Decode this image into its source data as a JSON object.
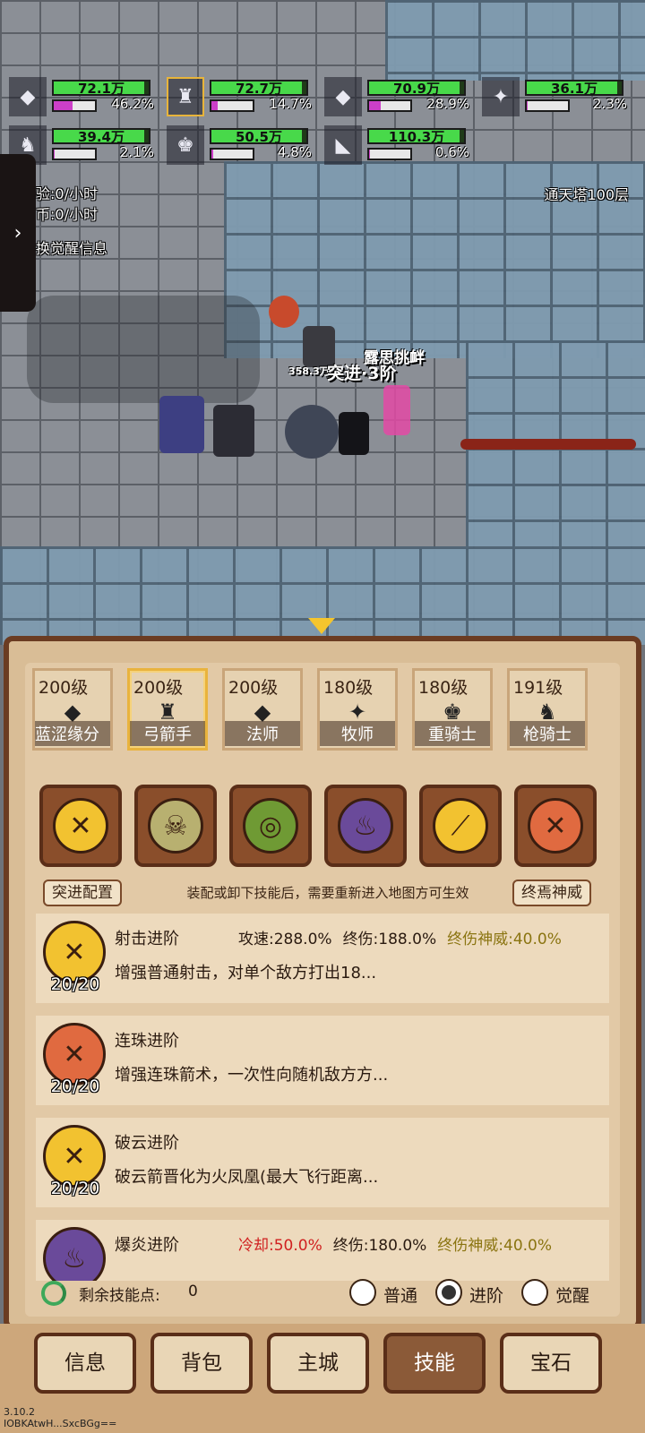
{
  "units": [
    {
      "hp_text": "72.1万",
      "hp_fraction": 0.95,
      "mp_text": "46.2%",
      "mp_fraction": 0.462,
      "icon": "ghost-sprite-icon",
      "selected": false
    },
    {
      "hp_text": "72.7万",
      "hp_fraction": 0.95,
      "mp_text": "14.7%",
      "mp_fraction": 0.147,
      "icon": "archer-sprite-icon",
      "selected": true
    },
    {
      "hp_text": "70.9万",
      "hp_fraction": 0.95,
      "mp_text": "28.9%",
      "mp_fraction": 0.289,
      "icon": "ghost-sprite-icon",
      "selected": false
    },
    {
      "hp_text": "36.1万",
      "hp_fraction": 0.95,
      "mp_text": "2.3%",
      "mp_fraction": 0.023,
      "icon": "priest-sprite-icon",
      "selected": false
    },
    {
      "hp_text": "39.4万",
      "hp_fraction": 0.95,
      "mp_text": "2.1%",
      "mp_fraction": 0.021,
      "icon": "lancer-sprite-icon",
      "selected": false
    },
    {
      "hp_text": "50.5万",
      "hp_fraction": 0.95,
      "mp_text": "4.8%",
      "mp_fraction": 0.048,
      "icon": "knight-sprite-icon",
      "selected": false
    },
    {
      "hp_text": "110.3万",
      "hp_fraction": 0.95,
      "mp_text": "0.6%",
      "mp_fraction": 0.006,
      "icon": "cat-sprite-icon",
      "selected": false
    }
  ],
  "left_info": {
    "exp_rate": "验:0/小时",
    "coin_rate": "币:0/小时",
    "awaken_info": "换觉醒信息"
  },
  "tower_label": "通天塔100层",
  "battle": {
    "damage_text": "358.3万",
    "skill_popup": "突进·3阶",
    "taunt_popup": "露思挑衅"
  },
  "heroes": [
    {
      "level": "200级",
      "name": "蓝涩缘分（",
      "icon": "ghost-sprite-icon"
    },
    {
      "level": "200级",
      "name": "弓箭手",
      "icon": "archer-sprite-icon"
    },
    {
      "level": "200级",
      "name": "法师",
      "icon": "ghost-sprite-icon"
    },
    {
      "level": "180级",
      "name": "牧师",
      "icon": "priest-sprite-icon"
    },
    {
      "level": "180级",
      "name": "重骑士",
      "icon": "knight-sprite-icon"
    },
    {
      "level": "191级",
      "name": "枪骑士",
      "icon": "lancer-sprite-icon"
    }
  ],
  "skill_slots": [
    {
      "icon": "crossed-arrows-icon",
      "color": "#f2c230"
    },
    {
      "icon": "skull-icon",
      "color": "#b8b070"
    },
    {
      "icon": "swirl-icon",
      "color": "#6f9a34"
    },
    {
      "icon": "flame-staff-icon",
      "color": "#6a4a9a"
    },
    {
      "icon": "spear-icon",
      "color": "#f2c230"
    },
    {
      "icon": "flame-arrows-icon",
      "color": "#e06a40"
    }
  ],
  "config_button": "突进配置",
  "config_note": "装配或卸下技能后，需要重新进入地图方可生效",
  "terminal_button": "终焉神威",
  "skills": [
    {
      "name": "射击进阶",
      "count": "20/20",
      "icon": "crossed-arrows-icon",
      "color": "#f2c230",
      "stat1": "攻速:288.0%",
      "stat2": "终伤:188.0%",
      "stat3": "终伤神威:40.0%",
      "desc": "增强普通射击，对单个敌方打出18..."
    },
    {
      "name": "连珠进阶",
      "count": "20/20",
      "icon": "flame-arrows-icon",
      "color": "#e06a40",
      "stat1": "",
      "stat2": "",
      "stat3": "",
      "desc": "增强连珠箭术，一次性向随机敌方方..."
    },
    {
      "name": "破云进阶",
      "count": "20/20",
      "icon": "crossed-arrows-icon",
      "color": "#f2c230",
      "stat1": "",
      "stat2": "",
      "stat3": "",
      "desc": "破云箭晋化为火凤凰(最大飞行距离..."
    },
    {
      "name": "爆炎进阶",
      "count": "",
      "icon": "flame-staff-icon",
      "color": "#6a4a9a",
      "stat1": "冷却:50.0%",
      "stat2": "终伤:180.0%",
      "stat3": "终伤神威:40.0%",
      "desc": ""
    }
  ],
  "skill_points_label": "剩余技能点:",
  "skill_points_value": "0",
  "modes": [
    {
      "label": "普通",
      "checked": false
    },
    {
      "label": "进阶",
      "checked": true
    },
    {
      "label": "觉醒",
      "checked": false
    }
  ],
  "nav": [
    {
      "label": "信息",
      "active": false
    },
    {
      "label": "背包",
      "active": false
    },
    {
      "label": "主城",
      "active": false
    },
    {
      "label": "技能",
      "active": true
    },
    {
      "label": "宝石",
      "active": false
    }
  ],
  "version": "3.10.2",
  "build_code": "IOBKAtwH...SxcBGg=="
}
